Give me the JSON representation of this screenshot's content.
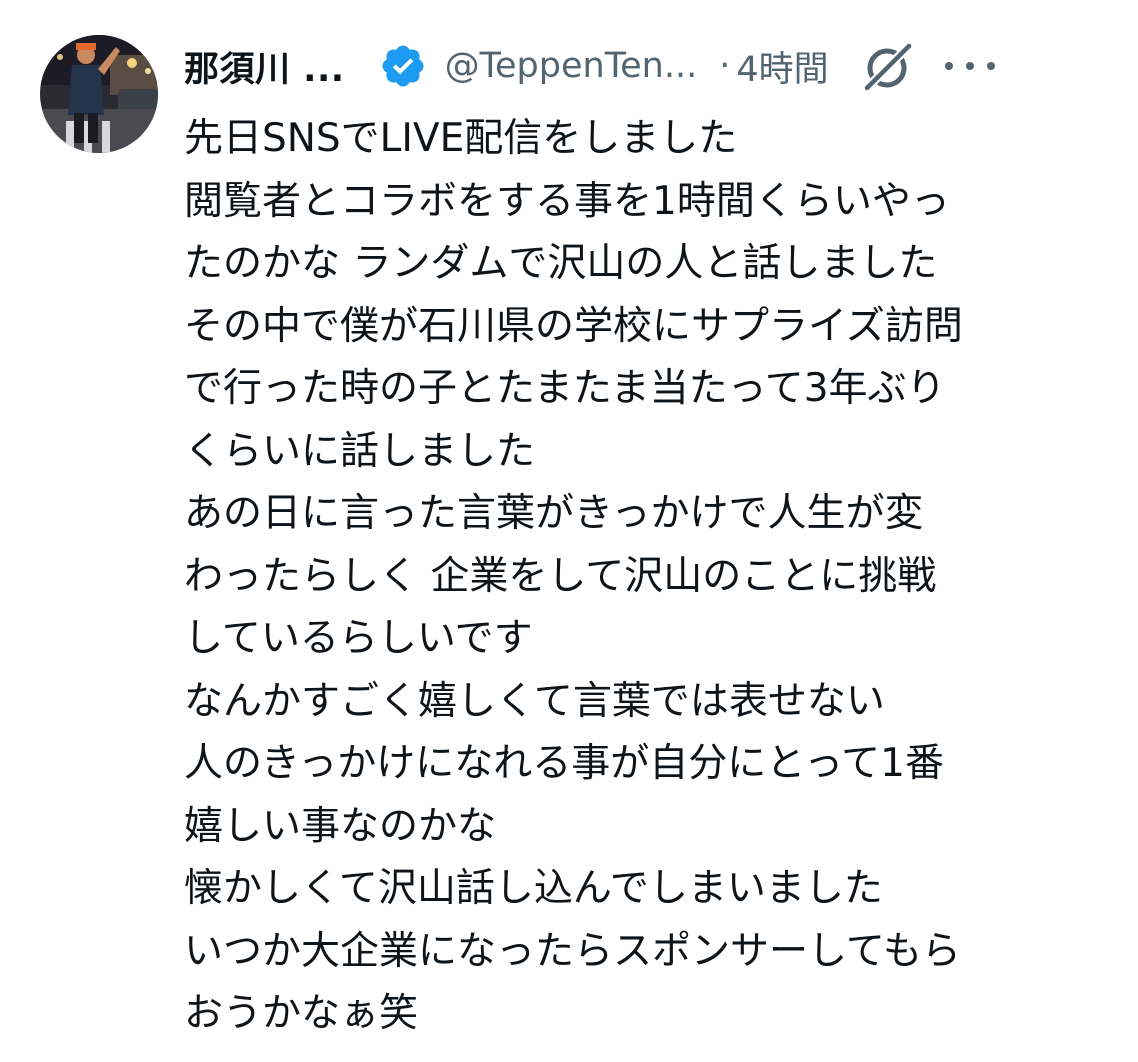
{
  "author": {
    "name": "那須川 ...",
    "handle": "@TeppenTen...",
    "separator": "·",
    "time": "4時間"
  },
  "icons": {
    "avatar": "profile-photo",
    "verified": "verified-badge-icon",
    "grok": "grok-icon",
    "more": "more-options-icon"
  },
  "colors": {
    "verified": "#1d9bf0",
    "text": "#0f1419",
    "secondary": "#536471"
  },
  "tweet": {
    "lines": [
      "先日SNSでLIVE配信をしました",
      "閲覧者とコラボをする事を1時間くらいやっ",
      "たのかな ランダムで沢山の人と話しました",
      "その中で僕が石川県の学校にサプライズ訪問",
      "で行った時の子とたまたま当たって3年ぶり",
      "くらいに話しました",
      "あの日に言った言葉がきっかけで人生が変",
      "わったらしく 企業をして沢山のことに挑戦",
      "しているらしいです",
      "なんかすごく嬉しくて言葉では表せない",
      "人のきっかけになれる事が自分にとって1番",
      "嬉しい事なのかな",
      "懐かしくて沢山話し込んでしまいました",
      "いつか大企業になったらスポンサーしてもら",
      "おうかなぁ笑"
    ]
  }
}
